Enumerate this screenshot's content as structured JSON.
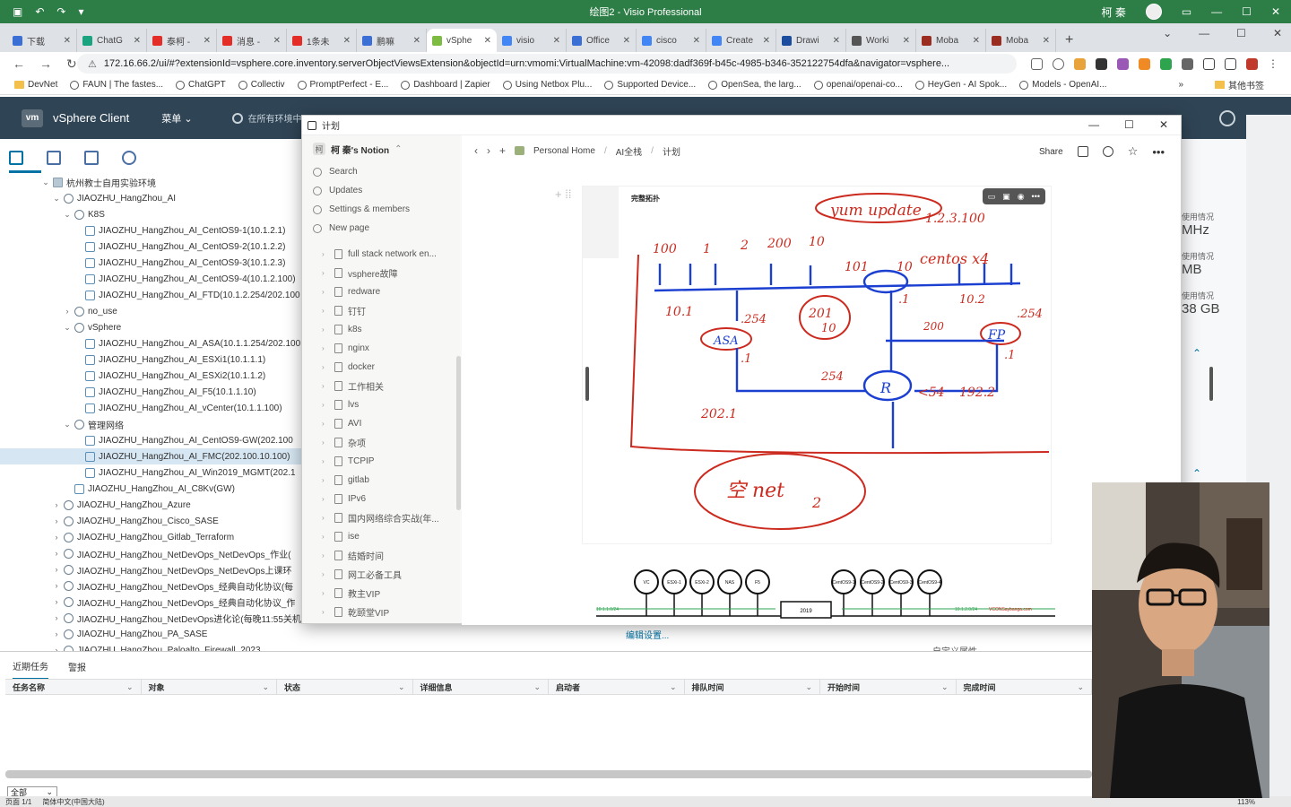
{
  "visio": {
    "title": "绘图2 - Visio Professional",
    "user": "柯 秦"
  },
  "browser": {
    "tabs": [
      {
        "label": "下载",
        "color": "#3b6fd6"
      },
      {
        "label": "ChatG",
        "color": "#19a37f"
      },
      {
        "label": "泰柯 -",
        "color": "#e52d27"
      },
      {
        "label": "消息 -",
        "color": "#e52d27"
      },
      {
        "label": "1条未",
        "color": "#e52d27"
      },
      {
        "label": "鹏嘛",
        "color": "#3b6fd6"
      },
      {
        "label": "vSphe",
        "color": "#7dbb42"
      },
      {
        "label": "visio",
        "color": "#4285f4"
      },
      {
        "label": "Office",
        "color": "#3b6fd6"
      },
      {
        "label": "cisco",
        "color": "#4285f4"
      },
      {
        "label": "Create",
        "color": "#4285f4"
      },
      {
        "label": "Drawi",
        "color": "#1a4d9e"
      },
      {
        "label": "Worki",
        "color": "#555555"
      },
      {
        "label": "Moba",
        "color": "#9b2d20"
      },
      {
        "label": "Moba",
        "color": "#9b2d20"
      }
    ],
    "active_tab": 6,
    "url": "172.16.66.2/ui/#?extensionId=vsphere.core.inventory.serverObjectViewsExtension&objectId=urn:vmomi:VirtualMachine:vm-42098:dadf369f-b45c-4985-b346-352122754dfa&navigator=vsphere...",
    "bookmarks": [
      "DevNet",
      "FAUN | The fastes...",
      "ChatGPT",
      "Collectiv",
      "PromptPerfect - E...",
      "Dashboard | Zapier",
      "Using Netbox Plu...",
      "Supported Device...",
      "OpenSea, the larg...",
      "openai/openai-co...",
      "HeyGen - AI Spok...",
      "Models - OpenAI..."
    ],
    "bookmarks_more": "»",
    "bookmarks_other": "其他书签"
  },
  "vsphere": {
    "logo": "vm",
    "title": "vSphere Client",
    "menu": "菜单",
    "search_placeholder": "在所有环境中",
    "tree": [
      {
        "indent": 3,
        "tw": "⌄",
        "icon": "folder",
        "label": "杭州教士自用实验环境"
      },
      {
        "indent": 4,
        "tw": "⌄",
        "icon": "dc",
        "label": "JIAOZHU_HangZhou_AI"
      },
      {
        "indent": 5,
        "tw": "⌄",
        "icon": "dc",
        "label": "K8S"
      },
      {
        "indent": 6,
        "tw": "",
        "icon": "vm",
        "label": "JIAOZHU_HangZhou_AI_CentOS9-1(10.1.2.1)"
      },
      {
        "indent": 6,
        "tw": "",
        "icon": "vm",
        "label": "JIAOZHU_HangZhou_AI_CentOS9-2(10.1.2.2)"
      },
      {
        "indent": 6,
        "tw": "",
        "icon": "vm",
        "label": "JIAOZHU_HangZhou_AI_CentOS9-3(10.1.2.3)"
      },
      {
        "indent": 6,
        "tw": "",
        "icon": "vm",
        "label": "JIAOZHU_HangZhou_AI_CentOS9-4(10.1.2.100)"
      },
      {
        "indent": 6,
        "tw": "",
        "icon": "vm",
        "label": "JIAOZHU_HangZhou_AI_FTD(10.1.2.254/202.100"
      },
      {
        "indent": 5,
        "tw": "›",
        "icon": "dc",
        "label": "no_use"
      },
      {
        "indent": 5,
        "tw": "⌄",
        "icon": "dc",
        "label": "vSphere"
      },
      {
        "indent": 6,
        "tw": "",
        "icon": "vm",
        "label": "JIAOZHU_HangZhou_AI_ASA(10.1.1.254/202.100"
      },
      {
        "indent": 6,
        "tw": "",
        "icon": "vm",
        "label": "JIAOZHU_HangZhou_AI_ESXi1(10.1.1.1)"
      },
      {
        "indent": 6,
        "tw": "",
        "icon": "vm",
        "label": "JIAOZHU_HangZhou_AI_ESXi2(10.1.1.2)"
      },
      {
        "indent": 6,
        "tw": "",
        "icon": "vm",
        "label": "JIAOZHU_HangZhou_AI_F5(10.1.1.10)"
      },
      {
        "indent": 6,
        "tw": "",
        "icon": "vm",
        "label": "JIAOZHU_HangZhou_AI_vCenter(10.1.1.100)"
      },
      {
        "indent": 5,
        "tw": "⌄",
        "icon": "dc",
        "label": "管理网络"
      },
      {
        "indent": 6,
        "tw": "",
        "icon": "vm",
        "label": "JIAOZHU_HangZhou_AI_CentOS9-GW(202.100"
      },
      {
        "indent": 6,
        "tw": "",
        "icon": "vm",
        "label": "JIAOZHU_HangZhou_AI_FMC(202.100.10.100)",
        "selected": true
      },
      {
        "indent": 6,
        "tw": "",
        "icon": "vm",
        "label": "JIAOZHU_HangZhou_AI_Win2019_MGMT(202.1"
      },
      {
        "indent": 5,
        "tw": "",
        "icon": "vm",
        "label": "JIAOZHU_HangZhou_AI_C8Kv(GW)"
      },
      {
        "indent": 4,
        "tw": "›",
        "icon": "dc",
        "label": "JIAOZHU_HangZhou_Azure"
      },
      {
        "indent": 4,
        "tw": "›",
        "icon": "dc",
        "label": "JIAOZHU_HangZhou_Cisco_SASE"
      },
      {
        "indent": 4,
        "tw": "›",
        "icon": "dc",
        "label": "JIAOZHU_HangZhou_Gitlab_Terraform"
      },
      {
        "indent": 4,
        "tw": "›",
        "icon": "dc",
        "label": "JIAOZHU_HangZhou_NetDevOps_NetDevOps_作业("
      },
      {
        "indent": 4,
        "tw": "›",
        "icon": "dc",
        "label": "JIAOZHU_HangZhou_NetDevOps_NetDevOps上课环"
      },
      {
        "indent": 4,
        "tw": "›",
        "icon": "dc",
        "label": "JIAOZHU_HangZhou_NetDevOps_经典自动化协议(每"
      },
      {
        "indent": 4,
        "tw": "›",
        "icon": "dc",
        "label": "JIAOZHU_HangZhou_NetDevOps_经典自动化协议_作"
      },
      {
        "indent": 4,
        "tw": "›",
        "icon": "dc",
        "label": "JIAOZHU_HangZhou_NetDevOps进化论(每晚11:55关机"
      },
      {
        "indent": 4,
        "tw": "›",
        "icon": "dc",
        "label": "JIAOZHU_HangZhou_PA_SASE"
      },
      {
        "indent": 4,
        "tw": "›",
        "icon": "dc",
        "label": "JIAOZHU_HangZhou_Paloalto_Firewall_2023"
      }
    ],
    "stats": [
      {
        "label": "使用情况",
        "value": "MHz"
      },
      {
        "label": "使用情况",
        "value": "MB"
      },
      {
        "label": "使用情况",
        "value": "38 GB"
      }
    ],
    "edit_settings": "编辑设置...",
    "custom_attrs": "自定义属性"
  },
  "notion": {
    "window_title": "计划",
    "workspace": "柯 秦's Notion",
    "workspace_initial": "柯",
    "nav": [
      "Search",
      "Updates",
      "Settings & members",
      "New page"
    ],
    "pages": [
      "full stack network en...",
      "vsphere故障",
      "redware",
      "钉钉",
      "k8s",
      "nginx",
      "docker",
      "工作相关",
      "lvs",
      "AVI",
      "杂项",
      "TCPIP",
      "gitlab",
      "IPv6",
      "国内网络综合实战(年...",
      "ise",
      "结婚时间",
      "网工必备工具",
      "教主VIP",
      "乾颐堂VIP"
    ],
    "breadcrumb": [
      "Personal Home",
      "AI全栈",
      "计划"
    ],
    "share": "Share",
    "embed_title": "完整拓扑",
    "diagram": {
      "nodes_top": [
        "VC",
        "ESXi-1",
        "ESXi-2",
        "NAS",
        "F5",
        "CentOS9-1",
        "CentOS9-2",
        "CentOS9-3",
        "CentOS9-4"
      ],
      "center": "2019",
      "left_net": "10.1.1.0/24",
      "right_net": "10.1.2.0/24",
      "brand": "VCONSaybanga.com",
      "handwriting": [
        "yum update",
        "1.2.3.100",
        "100",
        "1",
        "2",
        "200",
        "10",
        "101",
        "10",
        "centos x4",
        "10.1",
        ".254",
        "ASA",
        ".1",
        "201",
        "10",
        "254",
        "R",
        "202.1",
        ".1",
        "200",
        "10.2",
        ".254",
        "FP",
        ".1",
        "<54",
        "192.2",
        "空 net",
        "2"
      ]
    }
  },
  "tasks": {
    "tabs": [
      "近期任务",
      "警报"
    ],
    "columns": [
      "任务名称",
      "对象",
      "状态",
      "详细信息",
      "启动者",
      "排队时间",
      "开始时间",
      "完成时间"
    ],
    "filter": "全部"
  },
  "statusbar": {
    "page": "页面 1/1",
    "lang": "简体中文(中国大陆)",
    "zoom": "113%"
  }
}
